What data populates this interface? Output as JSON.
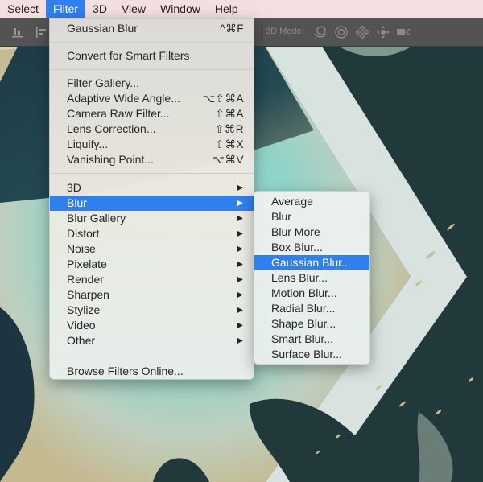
{
  "menubar": {
    "items": [
      {
        "label": "Select",
        "active": false
      },
      {
        "label": "Filter",
        "active": true
      },
      {
        "label": "3D",
        "active": false
      },
      {
        "label": "View",
        "active": false
      },
      {
        "label": "Window",
        "active": false
      },
      {
        "label": "Help",
        "active": false
      }
    ]
  },
  "optionsbar": {
    "mode_label": "3D Mode:",
    "icons": [
      "align-bottom-icon",
      "align-left-icon",
      "orbit-3d-icon",
      "roll-3d-icon",
      "pan-3d-icon",
      "slide-3d-icon",
      "scale-camera-icon"
    ]
  },
  "filter_menu": {
    "last_filter": {
      "label": "Gaussian Blur",
      "shortcut": "^⌘F"
    },
    "smart": {
      "label": "Convert for Smart Filters"
    },
    "group1": [
      {
        "label": "Filter Gallery...",
        "shortcut": ""
      },
      {
        "label": "Adaptive Wide Angle...",
        "shortcut": "⌥⇧⌘A"
      },
      {
        "label": "Camera Raw Filter...",
        "shortcut": "⇧⌘A"
      },
      {
        "label": "Lens Correction...",
        "shortcut": "⇧⌘R"
      },
      {
        "label": "Liquify...",
        "shortcut": "⇧⌘X"
      },
      {
        "label": "Vanishing Point...",
        "shortcut": "⌥⌘V"
      }
    ],
    "submenus": [
      {
        "label": "3D",
        "highlighted": false
      },
      {
        "label": "Blur",
        "highlighted": true
      },
      {
        "label": "Blur Gallery",
        "highlighted": false
      },
      {
        "label": "Distort",
        "highlighted": false
      },
      {
        "label": "Noise",
        "highlighted": false
      },
      {
        "label": "Pixelate",
        "highlighted": false
      },
      {
        "label": "Render",
        "highlighted": false
      },
      {
        "label": "Sharpen",
        "highlighted": false
      },
      {
        "label": "Stylize",
        "highlighted": false
      },
      {
        "label": "Video",
        "highlighted": false
      },
      {
        "label": "Other",
        "highlighted": false
      }
    ],
    "arrow": "▶",
    "browse": {
      "label": "Browse Filters Online..."
    }
  },
  "blur_submenu": {
    "items": [
      {
        "label": "Average",
        "highlighted": false
      },
      {
        "label": "Blur",
        "highlighted": false
      },
      {
        "label": "Blur More",
        "highlighted": false
      },
      {
        "label": "Box Blur...",
        "highlighted": false
      },
      {
        "label": "Gaussian Blur...",
        "highlighted": true
      },
      {
        "label": "Lens Blur...",
        "highlighted": false
      },
      {
        "label": "Motion Blur...",
        "highlighted": false
      },
      {
        "label": "Radial Blur...",
        "highlighted": false
      },
      {
        "label": "Shape Blur...",
        "highlighted": false
      },
      {
        "label": "Smart Blur...",
        "highlighted": false
      },
      {
        "label": "Surface Blur...",
        "highlighted": false
      }
    ]
  },
  "colors": {
    "highlight": "#2f80ee",
    "menubar_bg": "#f3dfe0",
    "optionsbar_bg": "#535353",
    "canvas_dark": "#22393c",
    "chevron_band": "#d8e3df",
    "watercolor": "#9fdcd4",
    "gold": "#c9b98f"
  }
}
